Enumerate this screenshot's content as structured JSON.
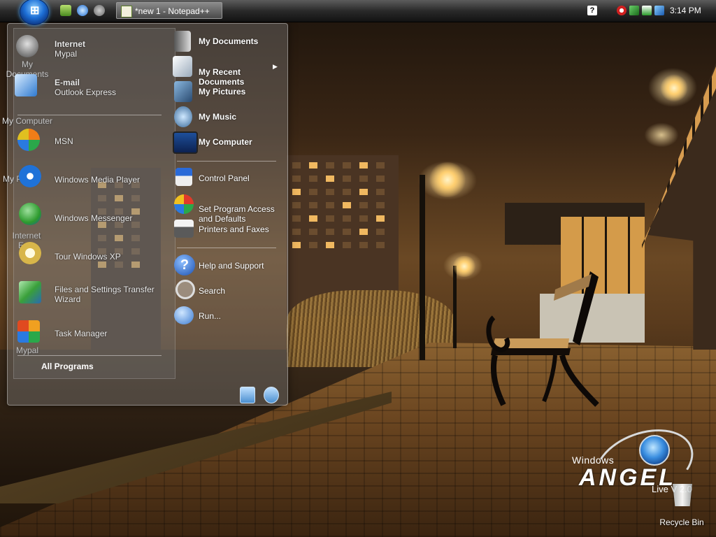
{
  "taskbar": {
    "task_label": "*new 1 - Notepad++",
    "clock": "3:14 PM"
  },
  "desktop_icons": {
    "my_documents": "My Documents",
    "my_computer": "My Computer",
    "my_pictures_fragment": "My Pi...",
    "internet_explorer_fragment": "Internet Ex...",
    "mypal": "Mypal",
    "recycle_bin": "Recycle Bin"
  },
  "brand": {
    "windows": "Windows",
    "angel": "ANGEL",
    "live": "Live V 2.0"
  },
  "start_menu": {
    "left": [
      {
        "title": "Internet",
        "subtitle": "Mypal",
        "icon": "mypal-raccoon-icon",
        "color": "#6a6a6a"
      },
      {
        "title": "E-mail",
        "subtitle": "Outlook Express",
        "icon": "outlook-express-icon",
        "color": "#2f7ad0"
      },
      {
        "title": "MSN",
        "icon": "msn-butterfly-icon",
        "color": "#f07d18"
      },
      {
        "title": "Windows Media Player",
        "icon": "media-player-icon",
        "color": "#1f72d8"
      },
      {
        "title": "Windows Messenger",
        "icon": "messenger-icon",
        "color": "#2d9a2d"
      },
      {
        "title": "Tour Windows XP",
        "icon": "tour-compass-icon",
        "color": "#d8b64a"
      },
      {
        "title": "Files and Settings Transfer",
        "subtitle": "Wizard",
        "icon": "transfer-wizard-icon",
        "color": "#3aa03a"
      },
      {
        "title": "Task Manager",
        "icon": "task-manager-icon",
        "color": "#f0a020"
      }
    ],
    "all_programs": "All Programs",
    "right": [
      {
        "title": "My Documents",
        "icon": "my-documents-icon"
      },
      {
        "title": "My Recent\nDocuments",
        "icon": "recent-documents-icon"
      },
      {
        "title": "My Pictures",
        "icon": "my-pictures-icon"
      },
      {
        "title": "My Music",
        "icon": "my-music-icon"
      },
      {
        "title": "My Computer",
        "icon": "my-computer-icon"
      },
      {
        "title": "Control Panel",
        "icon": "control-panel-icon"
      },
      {
        "title": "Set Program Access\nand Defaults",
        "icon": "program-access-icon"
      },
      {
        "title": "Printers and Faxes",
        "icon": "printer-icon"
      },
      {
        "title": "Help and Support",
        "icon": "help-icon"
      },
      {
        "title": "Search",
        "icon": "search-icon"
      },
      {
        "title": "Run...",
        "icon": "run-icon"
      }
    ]
  }
}
